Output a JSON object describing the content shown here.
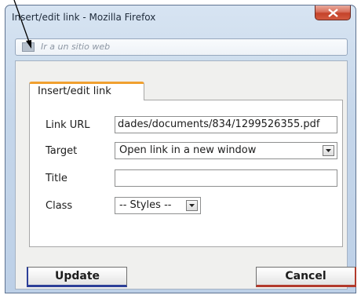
{
  "window": {
    "title": "Insert/edit link - Mozilla Firefox"
  },
  "address_bar": {
    "placeholder": "Ir a un sitio web"
  },
  "tab": {
    "label": "Insert/edit link"
  },
  "form": {
    "link_url": {
      "label": "Link URL",
      "value": "dades/documents/834/1299526355.pdf"
    },
    "target": {
      "label": "Target",
      "selected": "Open link in a new window"
    },
    "title": {
      "label": "Title",
      "value": ""
    },
    "class": {
      "label": "Class",
      "selected": "-- Styles --"
    }
  },
  "buttons": {
    "update": "Update",
    "cancel": "Cancel"
  },
  "icons": {
    "close": "close-icon",
    "address_page": "page-icon",
    "dropdown": "chevron-down-icon",
    "annotation": "arrow-icon"
  }
}
